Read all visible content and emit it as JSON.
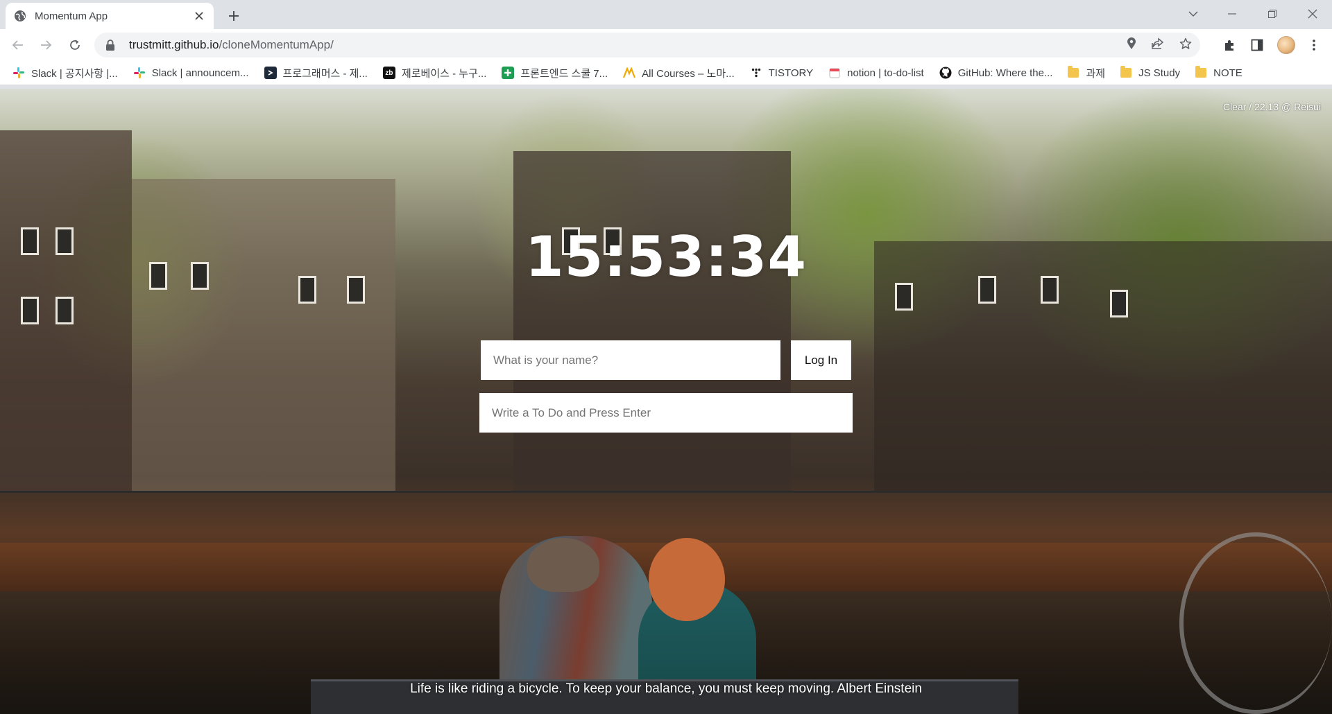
{
  "browser": {
    "tab_title": "Momentum App",
    "url_host": "trustmitt.github.io",
    "url_path": "/cloneMomentumApp/"
  },
  "bookmarks": [
    {
      "label": "Slack | 공지사항 |...",
      "icon": "slack-icon"
    },
    {
      "label": "Slack | announcem...",
      "icon": "slack-icon"
    },
    {
      "label": "프로그래머스 - 제...",
      "icon": "programmers-icon"
    },
    {
      "label": "제로베이스 - 누구...",
      "icon": "zb-icon",
      "icon_text": "zb"
    },
    {
      "label": "프론트엔드 스쿨 7...",
      "icon": "plus-green-icon"
    },
    {
      "label": "All Courses – 노마...",
      "icon": "nomad-icon"
    },
    {
      "label": "TISTORY",
      "icon": "tistory-icon"
    },
    {
      "label": "notion | to-do-list",
      "icon": "calendar-icon"
    },
    {
      "label": "GitHub: Where the...",
      "icon": "github-icon"
    },
    {
      "label": "과제",
      "icon": "folder-icon"
    },
    {
      "label": "JS Study",
      "icon": "folder-icon"
    },
    {
      "label": "NOTE",
      "icon": "folder-icon"
    }
  ],
  "app": {
    "weather": "Clear / 22.13 @ Reisui",
    "clock": "15:53:34",
    "login": {
      "placeholder": "What is your name?",
      "button_label": "Log In"
    },
    "todo": {
      "placeholder": "Write a To Do and Press Enter"
    },
    "quote": "Life is like riding a bicycle. To keep your balance, you must keep moving. Albert Einstein"
  },
  "colors": {
    "tab_strip": "#dee1e6",
    "slack": "#e01e5a",
    "programmers": "#1e2a3a",
    "zb": "#111111",
    "fe_school": "#1e9e52",
    "nomad": "#f2a900",
    "folder": "#f4c54d"
  }
}
